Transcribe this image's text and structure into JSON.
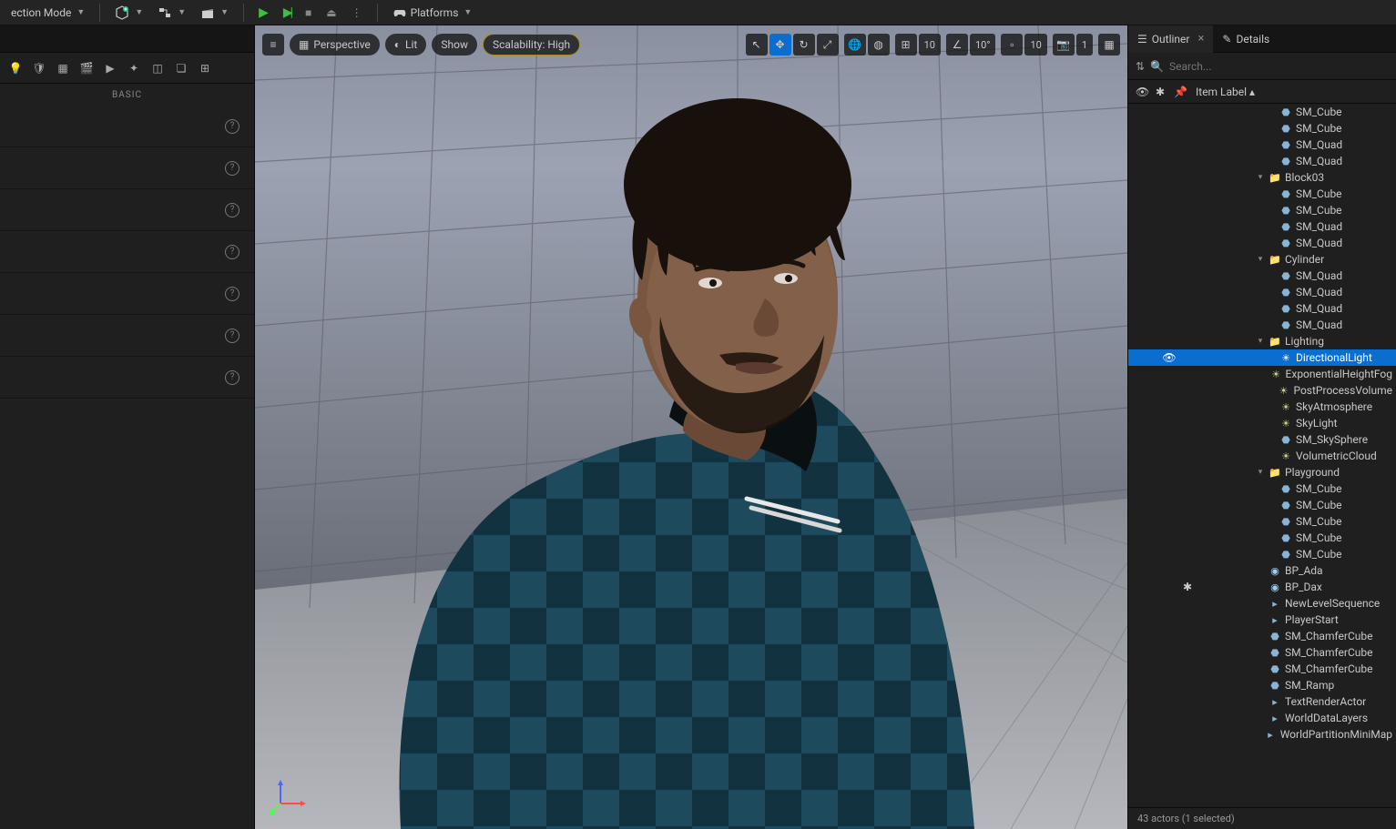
{
  "topbar": {
    "mode_label": "ection Mode",
    "platforms_label": "Platforms"
  },
  "left": {
    "basic_header": "BASIC",
    "rows": 7
  },
  "viewport": {
    "perspective": "Perspective",
    "lit": "Lit",
    "show": "Show",
    "scalability": "Scalability: High",
    "snap_translate": "10",
    "snap_rotate": "10°",
    "snap_scale": "10",
    "cam_speed": "1"
  },
  "right": {
    "outliner_tab": "Outliner",
    "details_tab": "Details",
    "search_placeholder": "Search...",
    "column_header": "Item Label",
    "status": "43 actors (1 selected)"
  },
  "tree": [
    {
      "d": 6,
      "t": "mesh",
      "l": "SM_Cube"
    },
    {
      "d": 6,
      "t": "mesh",
      "l": "SM_Cube"
    },
    {
      "d": 6,
      "t": "mesh",
      "l": "SM_Quad"
    },
    {
      "d": 6,
      "t": "mesh",
      "l": "SM_Quad"
    },
    {
      "d": 5,
      "t": "fold",
      "l": "Block03",
      "exp": true
    },
    {
      "d": 6,
      "t": "mesh",
      "l": "SM_Cube"
    },
    {
      "d": 6,
      "t": "mesh",
      "l": "SM_Cube"
    },
    {
      "d": 6,
      "t": "mesh",
      "l": "SM_Quad"
    },
    {
      "d": 6,
      "t": "mesh",
      "l": "SM_Quad"
    },
    {
      "d": 5,
      "t": "fold",
      "l": "Cylinder",
      "exp": true
    },
    {
      "d": 6,
      "t": "mesh",
      "l": "SM_Quad"
    },
    {
      "d": 6,
      "t": "mesh",
      "l": "SM_Quad"
    },
    {
      "d": 6,
      "t": "mesh",
      "l": "SM_Quad"
    },
    {
      "d": 6,
      "t": "mesh",
      "l": "SM_Quad"
    },
    {
      "d": 5,
      "t": "fold",
      "l": "Lighting",
      "exp": true
    },
    {
      "d": 6,
      "t": "light",
      "l": "DirectionalLight",
      "sel": true,
      "eye": true
    },
    {
      "d": 6,
      "t": "light",
      "l": "ExponentialHeightFog"
    },
    {
      "d": 6,
      "t": "light",
      "l": "PostProcessVolume"
    },
    {
      "d": 6,
      "t": "light",
      "l": "SkyAtmosphere"
    },
    {
      "d": 6,
      "t": "light",
      "l": "SkyLight"
    },
    {
      "d": 6,
      "t": "mesh",
      "l": "SM_SkySphere"
    },
    {
      "d": 6,
      "t": "light",
      "l": "VolumetricCloud"
    },
    {
      "d": 5,
      "t": "fold",
      "l": "Playground",
      "exp": true
    },
    {
      "d": 6,
      "t": "mesh",
      "l": "SM_Cube"
    },
    {
      "d": 6,
      "t": "mesh",
      "l": "SM_Cube"
    },
    {
      "d": 6,
      "t": "mesh",
      "l": "SM_Cube"
    },
    {
      "d": 6,
      "t": "mesh",
      "l": "SM_Cube"
    },
    {
      "d": 6,
      "t": "mesh",
      "l": "SM_Cube"
    },
    {
      "d": 5,
      "t": "bp",
      "l": "BP_Ada"
    },
    {
      "d": 5,
      "t": "bp",
      "l": "BP_Dax",
      "star": true
    },
    {
      "d": 5,
      "t": "misc",
      "l": "NewLevelSequence"
    },
    {
      "d": 5,
      "t": "misc",
      "l": "PlayerStart"
    },
    {
      "d": 5,
      "t": "mesh",
      "l": "SM_ChamferCube"
    },
    {
      "d": 5,
      "t": "mesh",
      "l": "SM_ChamferCube"
    },
    {
      "d": 5,
      "t": "mesh",
      "l": "SM_ChamferCube"
    },
    {
      "d": 5,
      "t": "mesh",
      "l": "SM_Ramp"
    },
    {
      "d": 5,
      "t": "misc",
      "l": "TextRenderActor"
    },
    {
      "d": 5,
      "t": "misc",
      "l": "WorldDataLayers"
    },
    {
      "d": 5,
      "t": "misc",
      "l": "WorldPartitionMiniMap"
    }
  ]
}
